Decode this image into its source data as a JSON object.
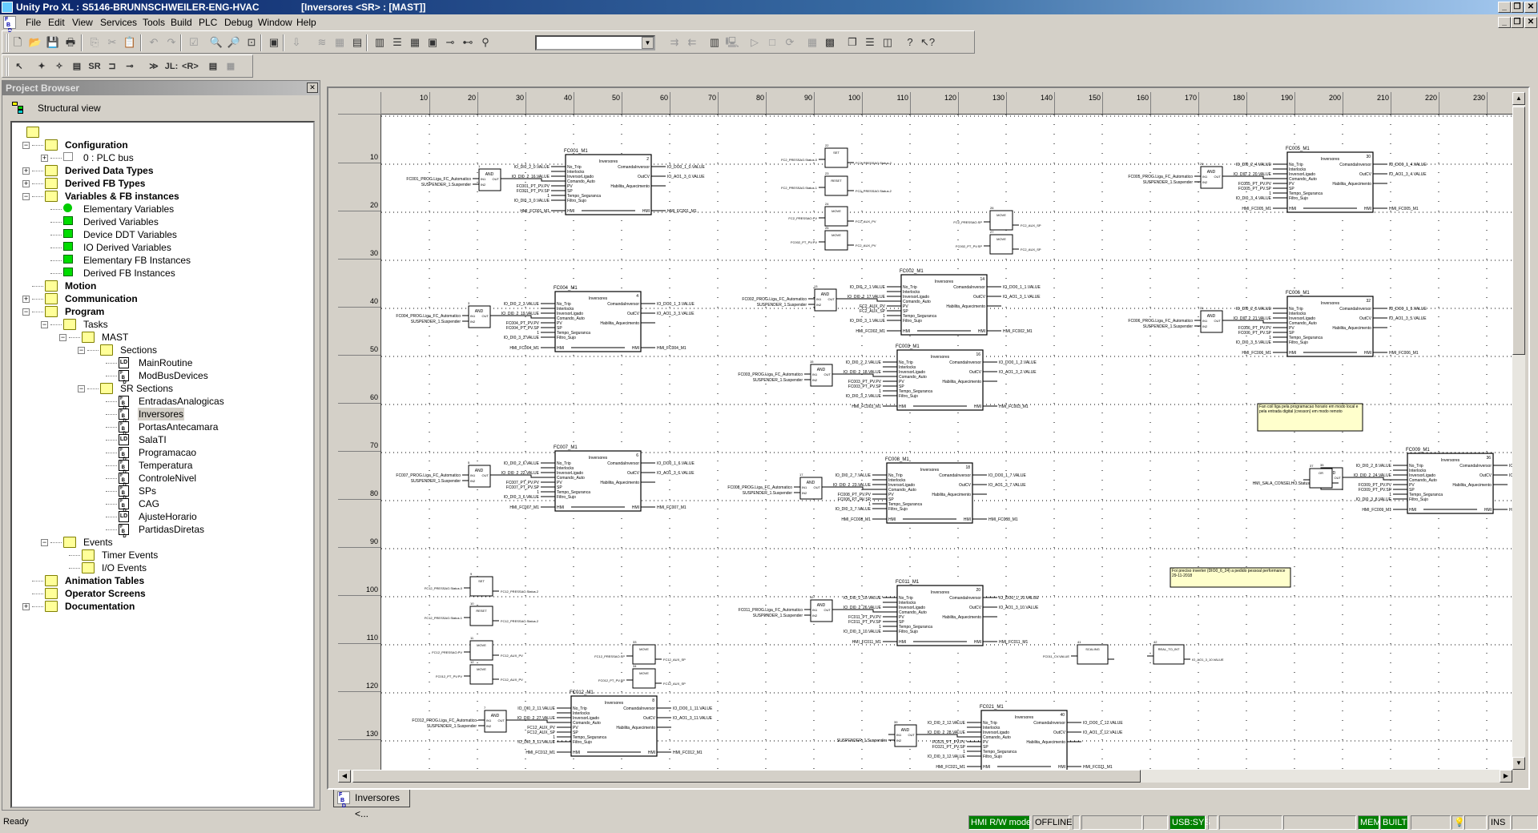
{
  "window": {
    "app_title": "Unity Pro XL : S5146-BRUNNSCHWEILER-ENG-HVAC",
    "doc_title": "[Inversores <SR> : [MAST]]",
    "minimize": "_",
    "restore": "❐",
    "close": "✕"
  },
  "menu": {
    "icon": "fbd-icon",
    "items": [
      "File",
      "Edit",
      "View",
      "Services",
      "Tools",
      "Build",
      "PLC",
      "Debug",
      "Window",
      "Help"
    ]
  },
  "toolbar1": {
    "icons": [
      "new-icon",
      "open-icon",
      "save-icon",
      "print-icon",
      "copy-icon",
      "cut-icon",
      "paste-icon",
      "undo-icon",
      "redo-icon",
      "validate-icon",
      "zoom-in-icon",
      "zoom-out-icon",
      "zoom-fit-icon",
      "fullscreen-icon",
      "import-icon",
      "analyze-icon",
      "build-changes-icon",
      "rebuild-icon",
      "project-browser-icon",
      "type-library-icon",
      "data-editor-icon",
      "memory-icon",
      "breakpoint-icon",
      "step-icon",
      "find-icon"
    ],
    "search_value": "",
    "icons2": [
      "transfer-to-plc-icon",
      "transfer-from-plc-icon",
      "io-icon",
      "connect-icon",
      "run-icon",
      "stop-icon",
      "init-icon",
      "animation-icon",
      "watch-icon",
      "cascade-icon",
      "tile-horizontal-icon",
      "tile-vertical-icon",
      "help-icon",
      "context-help-icon"
    ]
  },
  "toolbar2": {
    "icons": [
      "select-icon",
      "ffb-assistant-icon",
      "ffb-icon",
      "edit-ffb-icon",
      "sr-icon",
      "link-icon",
      "contact-icon",
      "jump-icon",
      "label-icon",
      "return-icon",
      "comment-icon",
      "animation-icon"
    ],
    "labels": {
      "sr": "SR",
      "jump": "≫",
      "label": "JL:",
      "return": "<R>"
    }
  },
  "project_browser": {
    "title": "Project Browser",
    "view_label": "Structural view",
    "tree": [
      {
        "label": "",
        "level": 0,
        "icon": "folder-open",
        "bold": false
      },
      {
        "label": "Configuration",
        "level": 1,
        "icon": "folder-open",
        "bold": true,
        "expander": "-"
      },
      {
        "label": "0 : PLC bus",
        "level": 2,
        "icon": "plc-bus",
        "bold": false,
        "expander": "+"
      },
      {
        "label": "Derived Data Types",
        "level": 1,
        "icon": "folder",
        "bold": true,
        "expander": "+"
      },
      {
        "label": "Derived FB Types",
        "level": 1,
        "icon": "folder",
        "bold": true,
        "expander": "+"
      },
      {
        "label": "Variables & FB instances",
        "level": 1,
        "icon": "folder-open",
        "bold": true,
        "expander": "-"
      },
      {
        "label": "Elementary Variables",
        "level": 2,
        "icon": "green-dot",
        "bold": false
      },
      {
        "label": "Derived Variables",
        "level": 2,
        "icon": "green-box",
        "bold": false
      },
      {
        "label": "Device DDT Variables",
        "level": 2,
        "icon": "green-box",
        "bold": false
      },
      {
        "label": "IO Derived Variables",
        "level": 2,
        "icon": "green-box",
        "bold": false
      },
      {
        "label": "Elementary FB Instances",
        "level": 2,
        "icon": "green-box",
        "bold": false
      },
      {
        "label": "Derived FB Instances",
        "level": 2,
        "icon": "green-box",
        "bold": false
      },
      {
        "label": "Motion",
        "level": 1,
        "icon": "folder",
        "bold": true
      },
      {
        "label": "Communication",
        "level": 1,
        "icon": "folder",
        "bold": true,
        "expander": "+"
      },
      {
        "label": "Program",
        "level": 1,
        "icon": "folder-open",
        "bold": true,
        "expander": "-"
      },
      {
        "label": "Tasks",
        "level": 2,
        "icon": "folder-open",
        "bold": false,
        "expander": "-"
      },
      {
        "label": "MAST",
        "level": 3,
        "icon": "folder-open",
        "bold": false,
        "expander": "-"
      },
      {
        "label": "Sections",
        "level": 4,
        "icon": "folder-open",
        "bold": false,
        "expander": "-"
      },
      {
        "label": "MainRoutine",
        "level": 5,
        "icon": "ld",
        "bold": false
      },
      {
        "label": "ModBusDevices",
        "level": 5,
        "icon": "fbd",
        "bold": false
      },
      {
        "label": "SR Sections",
        "level": 4,
        "icon": "folder-open",
        "bold": false,
        "expander": "-"
      },
      {
        "label": "EntradasAnalogicas",
        "level": 5,
        "icon": "fbd",
        "bold": false
      },
      {
        "label": "Inversores",
        "level": 5,
        "icon": "fbd",
        "bold": false,
        "selected": true
      },
      {
        "label": "PortasAntecamara",
        "level": 5,
        "icon": "fbd",
        "bold": false
      },
      {
        "label": "SalaTI",
        "level": 5,
        "icon": "ld",
        "bold": false
      },
      {
        "label": "Programacao",
        "level": 5,
        "icon": "fbd",
        "bold": false
      },
      {
        "label": "Temperatura",
        "level": 5,
        "icon": "fbd",
        "bold": false
      },
      {
        "label": "ControleNivel",
        "level": 5,
        "icon": "fbd",
        "bold": false
      },
      {
        "label": "SPs",
        "level": 5,
        "icon": "fbd",
        "bold": false
      },
      {
        "label": "CAG",
        "level": 5,
        "icon": "fbd",
        "bold": false
      },
      {
        "label": "AjusteHorario",
        "level": 5,
        "icon": "ld",
        "bold": false
      },
      {
        "label": "PartidasDiretas",
        "level": 5,
        "icon": "fbd",
        "bold": false
      },
      {
        "label": "Events",
        "level": 2,
        "icon": "folder-open",
        "bold": false,
        "expander": "-"
      },
      {
        "label": "Timer Events",
        "level": 3,
        "icon": "folder",
        "bold": false
      },
      {
        "label": "I/O Events",
        "level": 3,
        "icon": "folder",
        "bold": false
      },
      {
        "label": "Animation Tables",
        "level": 1,
        "icon": "folder",
        "bold": true
      },
      {
        "label": "Operator Screens",
        "level": 1,
        "icon": "folder",
        "bold": true
      },
      {
        "label": "Documentation",
        "level": 1,
        "icon": "documentation",
        "bold": true,
        "expander": "+"
      }
    ]
  },
  "editor": {
    "column_ruler": [
      "10",
      "20",
      "30",
      "40",
      "50",
      "60",
      "70",
      "80",
      "90",
      "100",
      "110",
      "120",
      "130",
      "140",
      "150",
      "160",
      "170",
      "180",
      "190",
      "200",
      "210",
      "220",
      "230"
    ],
    "row_ruler": [
      "10",
      "20",
      "30",
      "40",
      "50",
      "60",
      "70",
      "80",
      "90",
      "100",
      "110",
      "120",
      "130"
    ],
    "tab_label": "Inversores <...",
    "fb_type": "Inversores",
    "and_type": "AND",
    "fb_inputs": [
      "No_Trip",
      "Interlocks",
      "InversorLigado",
      "Comando_Auto",
      "PV",
      "SP",
      "Tempo_Seguranca",
      "Filtro_Sujo",
      "HMI"
    ],
    "fb_outputs": [
      "ComandaInversor",
      "OutCV",
      "Habilita_Aquecimento",
      "HMI"
    ],
    "and_pins": [
      "IN1",
      "IN2",
      "OUT"
    ],
    "blocks": [
      {
        "instance": "FC001_M1",
        "num": "2",
        "and_num": "1",
        "and_in": [
          "FC001_PROG.Liga_FC_Automatico",
          "SUSPENDER_1.Suspender"
        ],
        "in": [
          "IO_DI0_2_0.VALUE",
          "",
          "IO_DI0_2_16.VALUE",
          "",
          "FC001_PT_PV.PV",
          "FC001_PT_PV.SP",
          "1",
          "IO_DI0_3_0.VALUE",
          "HMI_FC001_M1"
        ],
        "out": [
          "IO_DO0_1_0.VALUE",
          "IO_AO1_3_0.VALUE",
          "",
          "HMI_FC001_M1"
        ]
      },
      {
        "instance": "FC004_M1",
        "num": "4",
        "and_num": "3",
        "and_in": [
          "FC004_PROG.Liga_FC_Automatico",
          "SUSPENDER_1.Suspender"
        ],
        "in": [
          "IO_DI0_2_3.VALUE",
          "",
          "IO_DI0_2_19.VALUE",
          "",
          "FC004_PT_PV.PV",
          "FC004_PT_PV.SP",
          "1",
          "IO_DI0_3_3.VALUE",
          "HMI_FC004_M1"
        ],
        "out": [
          "IO_DO0_1_3.VALUE",
          "IO_AO1_3_3.VALUE",
          "",
          "HMI_FC004_M1"
        ]
      },
      {
        "instance": "FC002_M1",
        "num": "14",
        "and_num": "13",
        "and_in": [
          "FC002_PROG.Liga_FC_Automatico",
          "SUSPENDER_1.Suspender"
        ],
        "in": [
          "IO_DI0_2_1.VALUE",
          "",
          "IO_DI0_2_17.VALUE",
          "",
          "FC2_AUX_PV",
          "FC2_AUX_SP",
          "1",
          "IO_DI0_3_1.VALUE",
          "HMI_FC002_M1"
        ],
        "out": [
          "IO_DO0_1_1.VALUE",
          "IO_AO1_3_1.VALUE",
          "",
          "HMI_FC002_M1"
        ]
      },
      {
        "instance": "FC003_M1",
        "num": "16",
        "and_num": "15",
        "and_in": [
          "FC003_PROG.Liga_FC_Automatico",
          "SUSPENDER_1.Suspender"
        ],
        "in": [
          "IO_DI0_2_2.VALUE",
          "",
          "IO_DI0_2_18.VALUE",
          "",
          "FC003_PT_PV.PV",
          "FC003_PT_PV.SP",
          "1",
          "IO_DI0_3_2.VALUE",
          "HMI_FC003_M1"
        ],
        "out": [
          "IO_DO0_1_2.VALUE",
          "IO_AO1_3_2.VALUE",
          "",
          "HMI_FC003_M1"
        ]
      },
      {
        "instance": "FC007_M1",
        "num": "6",
        "and_num": "5",
        "and_in": [
          "FC007_PROG.Liga_FC_Automatico",
          "SUSPENDER_1.Suspender"
        ],
        "in": [
          "IO_DI0_2_6.VALUE",
          "",
          "IO_DI0_2_22.VALUE",
          "",
          "FC007_PT_PV.PV",
          "FC007_PT_PV.SP",
          "1",
          "IO_DI0_3_6.VALUE",
          "HMI_FC007_M1"
        ],
        "out": [
          "IO_DO0_1_6.VALUE",
          "IO_AO1_3_6.VALUE",
          "",
          "HMI_FC007_M1"
        ]
      },
      {
        "instance": "FC008_M1",
        "num": "18",
        "and_num": "17",
        "and_in": [
          "FC008_PROG.Liga_FC_Automatico",
          "SUSPENDER_1.Suspender"
        ],
        "in": [
          "IO_DI0_2_7.VALUE",
          "",
          "IO_DI0_2_23.VALUE",
          "",
          "FC008_PT_PV.PV",
          "FC008_PT_PV.SP",
          "1",
          "IO_DI0_3_7.VALUE",
          "HMI_FC008_M1"
        ],
        "out": [
          "IO_DO0_1_7.VALUE",
          "IO_AO1_3_7.VALUE",
          "",
          "HMI_FC008_M1"
        ]
      },
      {
        "instance": "FC011_M1",
        "num": "20",
        "and_num": "19",
        "and_in": [
          "FC011_PROG.Liga_FC_Automatico",
          "SUSPENDER_1.Suspender"
        ],
        "in": [
          "IO_DI0_2_10.VALUE",
          "",
          "IO_DI0_2_26.VALUE",
          "",
          "FC011_PT_PV.PV",
          "FC011_PT_PV.SP",
          "1",
          "IO_DI0_3_10.VALUE",
          "HMI_FC011_M1"
        ],
        "out": [
          "IO_DO0_1_10.VALUE",
          "IO_AO1_3_10.VALUE",
          "",
          "HMI_FC011_M1"
        ]
      },
      {
        "instance": "FC012_M1",
        "num": "8",
        "and_num": "7",
        "and_in": [
          "FC012_PROG.Liga_FC_Automatico",
          "SUSPENDER_1.Suspender"
        ],
        "in": [
          "IO_DI0_2_11.VALUE",
          "",
          "IO_DI0_2_27.VALUE",
          "",
          "FC12_AUX_PV",
          "FC12_AUX_SP",
          "1",
          "IO_DI0_3_11.VALUE",
          "HMI_FC012_M1"
        ],
        "out": [
          "IO_DO0_1_11.VALUE",
          "IO_AO1_3_11.VALUE",
          "",
          "HMI_FC012_M1"
        ]
      },
      {
        "instance": "FC005_M1",
        "num": "30",
        "and_num": "29",
        "and_in": [
          "FC005_PROG.Liga_FC_Automatico",
          "SUSPENDER_1.Suspender"
        ],
        "in": [
          "IO_DI0_2_4.VALUE",
          "",
          "IO_DI0_2_20.VALUE",
          "",
          "FC005_PT_PV.PV",
          "FC005_PT_PV.SP",
          "1",
          "IO_DI0_3_4.VALUE",
          "HMI_FC005_M1"
        ],
        "out": [
          "IO_DO0_1_4.VALUE",
          "IO_AO1_3_4.VALUE",
          "",
          "HMI_FC005_M1"
        ]
      },
      {
        "instance": "FC006_M1",
        "num": "32",
        "and_num": "31",
        "and_in": [
          "FC006_PROG.Liga_FC_Automatico",
          "SUSPENDER_1.Suspender"
        ],
        "in": [
          "IO_DI0_2_5.VALUE",
          "",
          "IO_DI0_2_21.VALUE",
          "",
          "FC006_PT_PV.PV",
          "FC006_PT_PV.SP",
          "1",
          "IO_DI0_3_5.VALUE",
          "HMI_FC006_M1"
        ],
        "out": [
          "IO_DO0_1_5.VALUE",
          "IO_AO1_3_5.VALUE",
          "",
          "HMI_FC006_M1"
        ]
      },
      {
        "instance": "FC009_M1",
        "num": "36",
        "and_num": "35",
        "and_in": [
          "",
          "HMI_SALA_CONSELHO.Status.0"
        ],
        "in": [
          "IO_DI0_2_8.VALUE",
          "",
          "IO_DI0_2_24.VALUE",
          "",
          "FC009_PT_PV.PV",
          "FC009_PT_PV.SP",
          "1",
          "IO_DI0_3_8.VALUE",
          "HMI_FC009_M1"
        ],
        "out": [
          "IO_DO0_1_8.VALUE",
          "IO_AO1_3_8.VALUE",
          "",
          "HMI_FC009_M1"
        ]
      },
      {
        "instance": "FC021_M1",
        "num": "40",
        "and_num": "39",
        "and_in": [
          "",
          "SUSPENDER_1.Suspender"
        ],
        "in": [
          "IO_DI0_2_12.VALUE",
          "",
          "IO_DI0_2_28.VALUE",
          "",
          "FC021_PT_PV.PV",
          "FC021_PT_PV.SP",
          "1",
          "IO_DI0_3_12.VALUE",
          "HMI_FC021_M1"
        ],
        "out": [
          "IO_DO0_1_12.VALUE",
          "IO_AO1_3_12.VALUE",
          "",
          "HMI_FC021_M1"
        ]
      }
    ],
    "small_blocks": [
      {
        "type": "SET",
        "num": "22",
        "in": "FC2_PRESSAO.Status.0",
        "out": "FC2_PRESSAO.Status.2"
      },
      {
        "type": "RESET",
        "num": "23",
        "in": "FC2_PRESSAO.Status.1",
        "out": "FC2_PRESSAO.Status.2"
      },
      {
        "type": "MOVE",
        "num": "24",
        "in": "FC2_PRESSAO.PV",
        "out": "FC2_AUX_PV"
      },
      {
        "type": "MOVE",
        "num": "25",
        "in": "FC002_PT_PV.PV",
        "out": "FC2_AUX_PV"
      },
      {
        "type": "MOVE",
        "num": "26",
        "in": "FC2_PRESSAO.SP",
        "out": "FC2_AUX_SP"
      },
      {
        "type": "MOVE",
        "num": "27",
        "in": "FC002_PT_PV.SP",
        "out": "FC2_AUX_SP"
      },
      {
        "type": "SET",
        "num": "9",
        "in": "FC12_PRESSAO.Status.0",
        "out": "FC12_PRESSAO.Status.2"
      },
      {
        "type": "RESET",
        "num": "10",
        "in": "FC12_PRESSAO.Status.1",
        "out": "FC12_PRESSAO.Status.2"
      },
      {
        "type": "MOVE",
        "num": "11",
        "in": "FC12_PRESSAO.PV",
        "out": "FC12_AUX_PV"
      },
      {
        "type": "MOVE",
        "num": "12",
        "in": "FC012_PT_PV.PV",
        "out": "FC12_AUX_PV"
      },
      {
        "type": "MOVE",
        "num": "33",
        "in": "FC12_PRESSAO.SP",
        "out": "FC12_AUX_SP"
      },
      {
        "type": "MOVE",
        "num": "34",
        "in": "FC012_PT_PV.SP",
        "out": "FC12_AUX_SP"
      },
      {
        "type": "OR",
        "num": "37",
        "in": "",
        "out": ""
      },
      {
        "type": "SCALING",
        "num": "41",
        "in": "FC011_CV.VALUE",
        "out": ""
      },
      {
        "type": "REAL_TO_INT",
        "num": "42",
        "in": "",
        "out": "IO_AO1_3_10.VALUE"
      }
    ],
    "comments": [
      "Fan coil liga pela programacao horario em modo local e pela entrada digital (cresson) em modo remoto",
      "Foi preciso inverter (DIO0_6_24) a pedido pessoal performance 29-11-2018"
    ]
  },
  "status_bar": {
    "ready": "Ready",
    "hmi_mode": "HMI R/W mode",
    "connection": "OFFLINE",
    "address": "USB:SYS",
    "mem": "MEM",
    "built": "BUILT",
    "insert_mode": "INS",
    "colors": {
      "ok_green": "#008000"
    }
  }
}
